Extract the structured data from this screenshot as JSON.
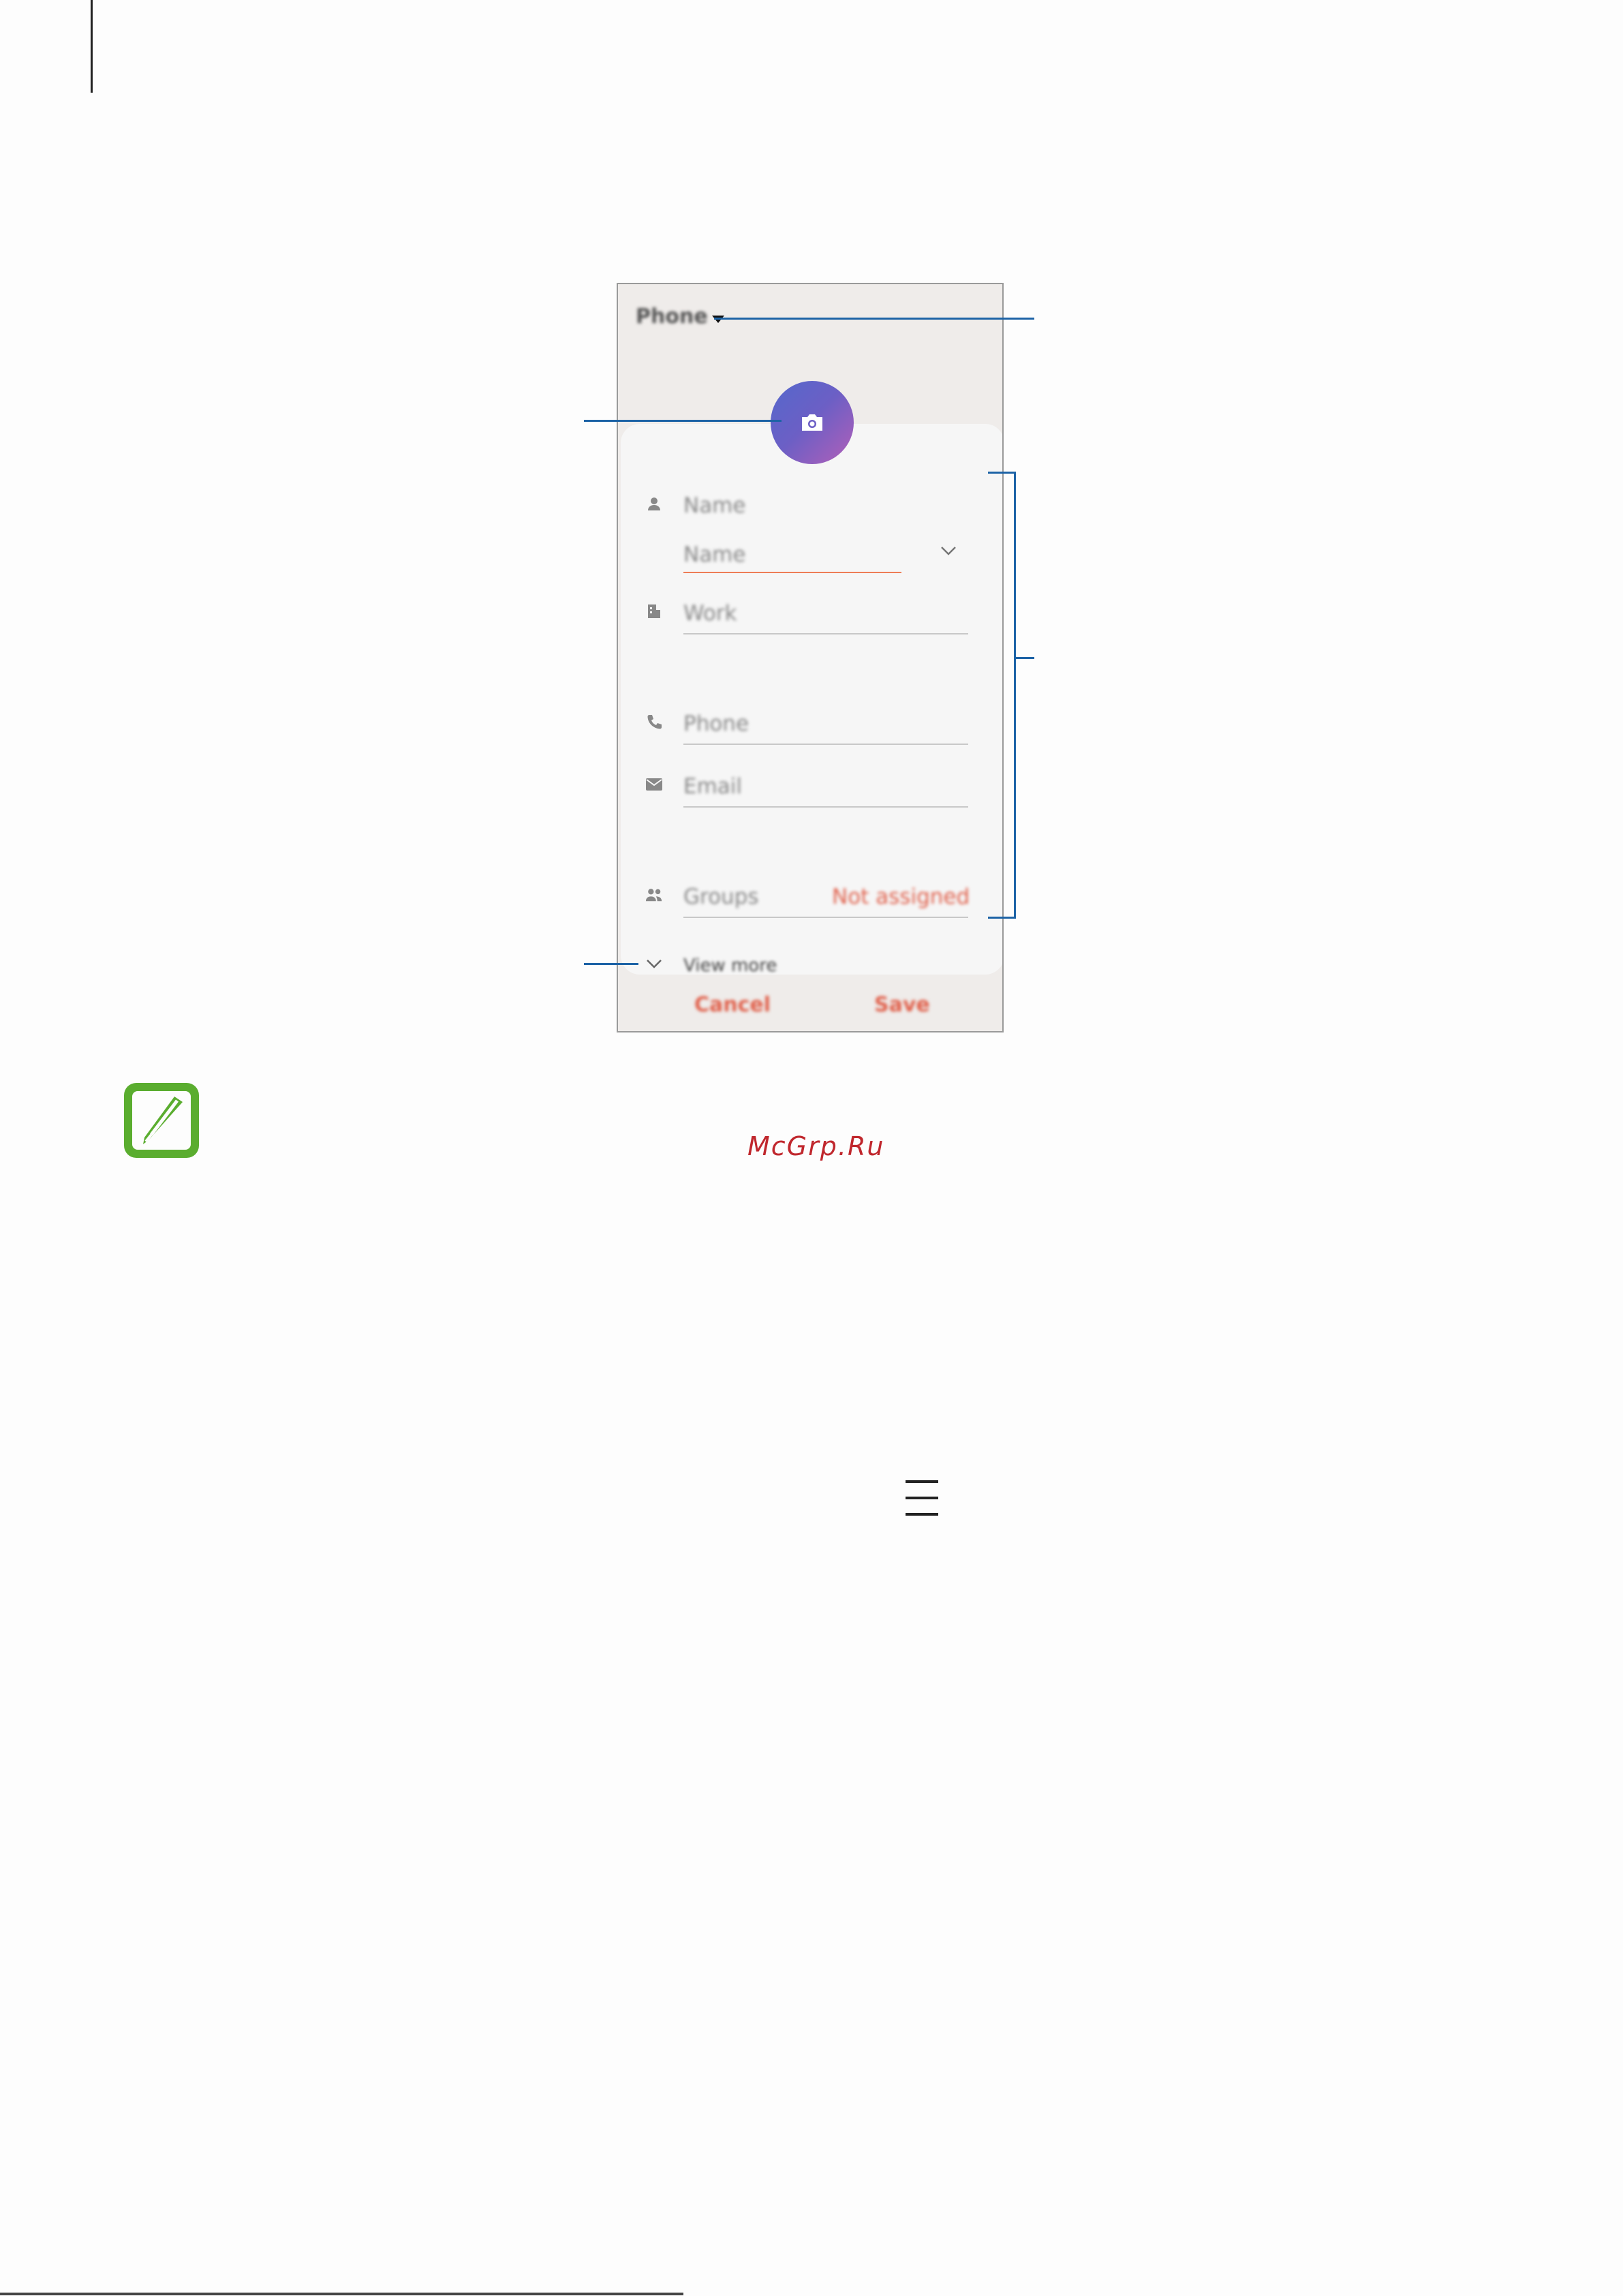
{
  "screen": {
    "account_selector": "Phone",
    "fields": {
      "name_label": "Name",
      "name_sub": "Name",
      "work": "Work",
      "phone": "Phone",
      "email": "Email",
      "groups": "Groups",
      "groups_value": "Not assigned",
      "view_more": "View more"
    },
    "buttons": {
      "cancel": "Cancel",
      "save": "Save"
    }
  },
  "watermark": "McGrp.Ru",
  "colors": {
    "accent": "#e0604b",
    "callout": "#1d63a6",
    "note_green": "#5aad2f"
  },
  "icons": [
    "camera-icon",
    "person-icon",
    "building-icon",
    "phone-icon",
    "email-icon",
    "groups-icon",
    "chevron-down-icon",
    "note-icon",
    "menu-icon"
  ]
}
